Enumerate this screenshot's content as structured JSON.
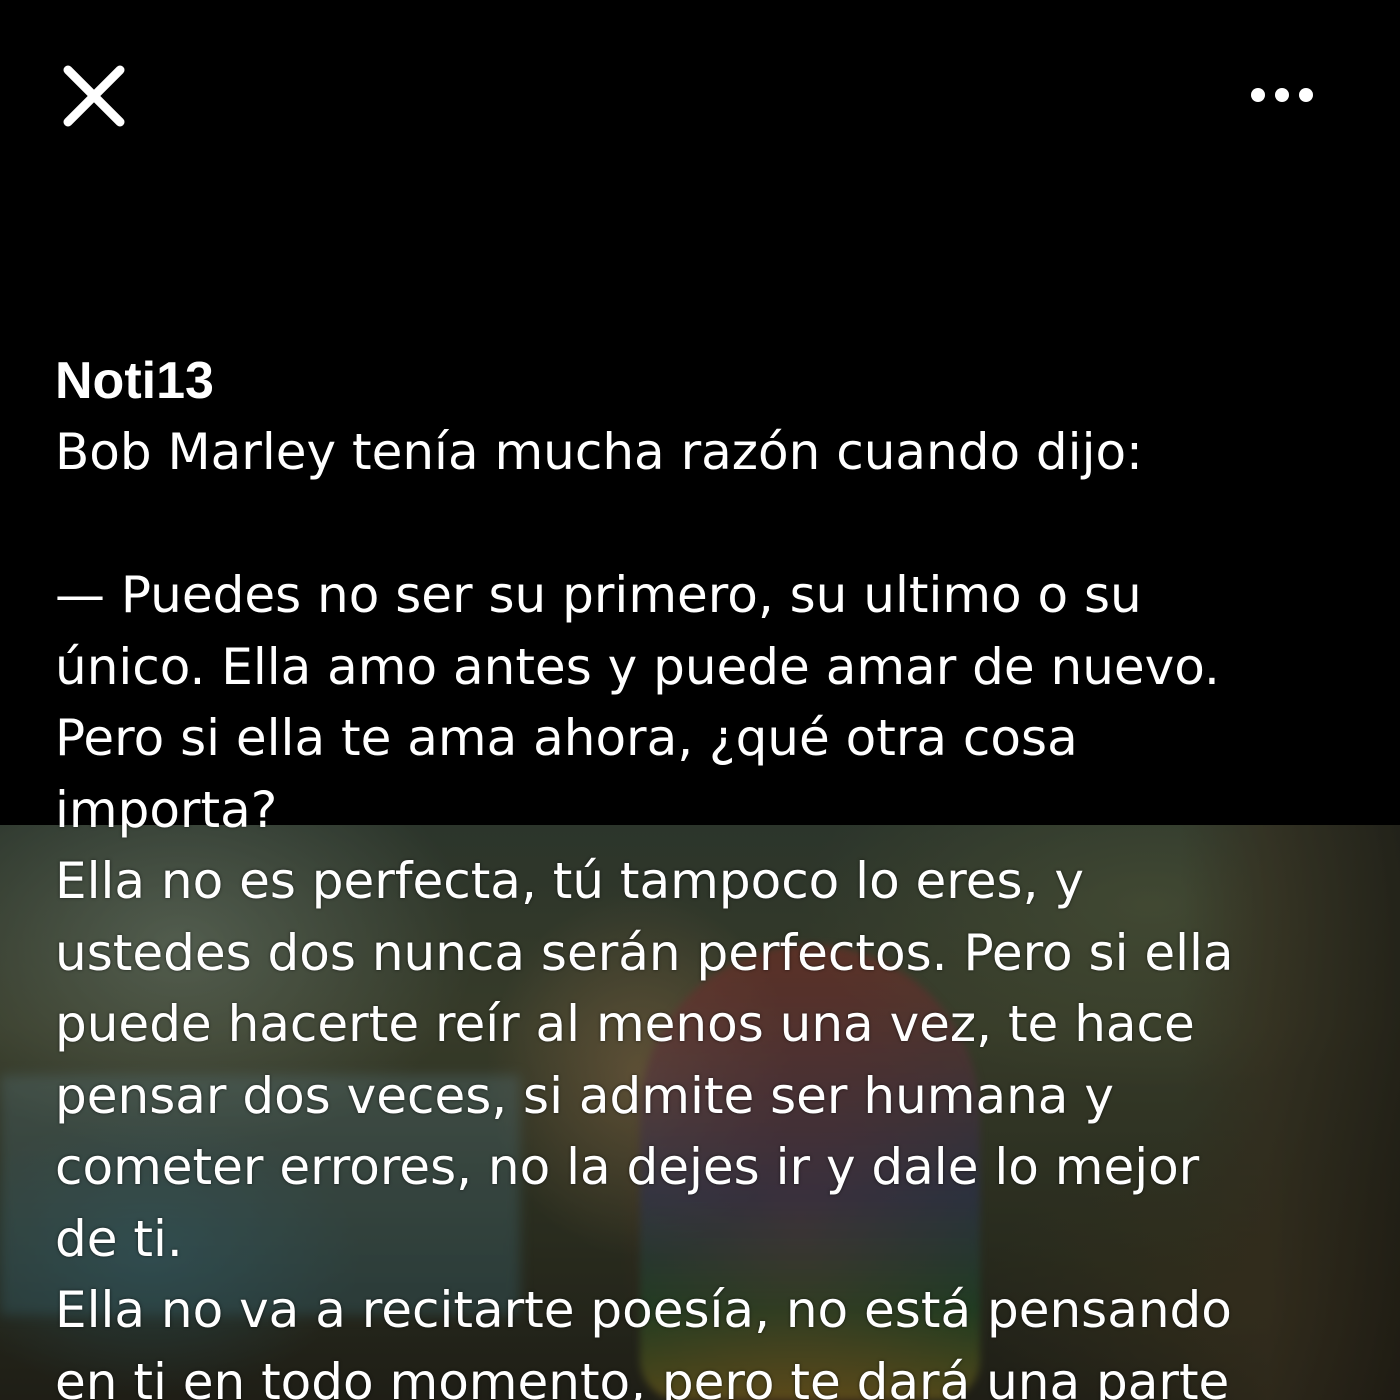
{
  "header": {
    "close_icon": "close-icon",
    "more_icon": "more-options-icon"
  },
  "post": {
    "author": "Noti13",
    "text": "Bob Marley tenía mucha razón cuando dijo:\n\n— Puedes no ser su primero, su ultimo o su\núnico. Ella amo antes y puede amar de nuevo.\nPero si ella te ama ahora, ¿qué otra cosa\nimporta?\nElla no es perfecta, tú tampoco lo eres, y\nustedes dos nunca serán perfectos. Pero si ella\npuede hacerte reír al menos una vez, te hace\npensar dos veces, si admite ser humana y\ncometer errores, no la dejes ir y dale lo mejor\nde ti.\nElla no va a recitarte poesía, no está pensando\nen ti en todo momento, pero te dará una parte"
  },
  "colors": {
    "background": "#000000",
    "text": "#ffffff"
  }
}
